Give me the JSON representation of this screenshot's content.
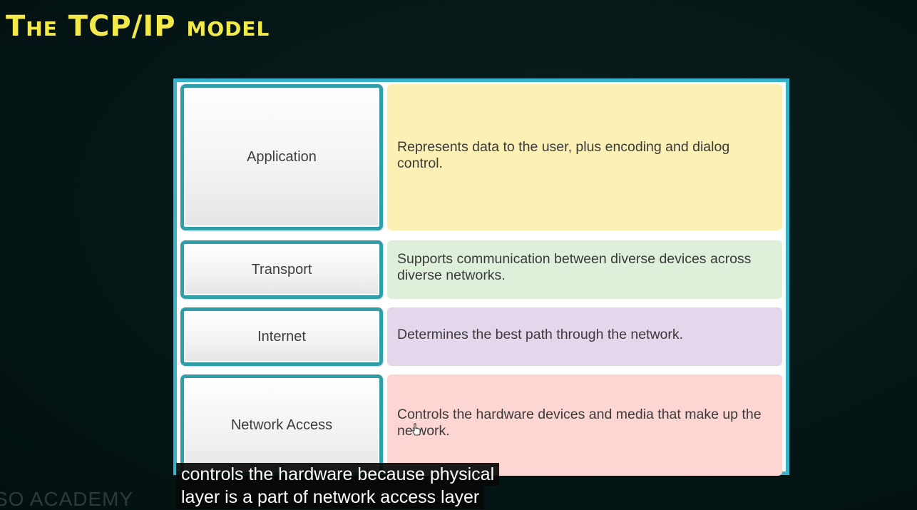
{
  "slide": {
    "title": "The TCP/IP model",
    "watermark": "SO ACADEMY"
  },
  "layers": [
    {
      "name": "Application",
      "description": "Represents data to the user, plus encoding and dialog control.",
      "color": "#fdf0b5"
    },
    {
      "name": "Transport",
      "description": "Supports communication between diverse devices across diverse networks.",
      "color": "#dff0da"
    },
    {
      "name": "Internet",
      "description": "Determines the best path through the network.",
      "color": "#e4d7ec"
    },
    {
      "name": "Network Access",
      "description": "Controls the hardware devices and media that make up the network.",
      "color": "#fdd5d2"
    }
  ],
  "caption": {
    "line1": "controls the hardware because physical",
    "line2": "layer is a part of network access layer"
  },
  "colors": {
    "title": "#f3ea4a",
    "frame": "#39b3cd",
    "label_border": "#2f9ea8",
    "background": "#051717"
  }
}
